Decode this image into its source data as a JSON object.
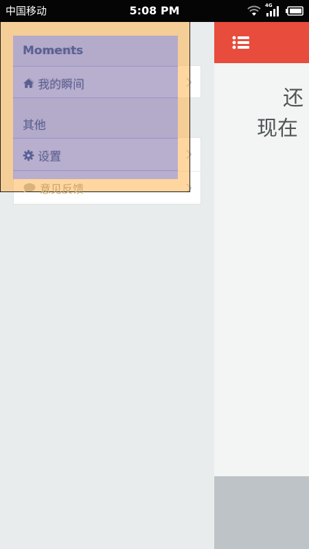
{
  "status_bar": {
    "carrier": "中国移动",
    "time": "5:08 PM",
    "network_type": "4G",
    "icons": [
      "wifi-icon",
      "signal-icon",
      "battery-icon"
    ]
  },
  "menu": {
    "sections": [
      {
        "title": "Moments",
        "items": [
          {
            "label": "我的瞬间",
            "icon": "home-icon"
          }
        ]
      },
      {
        "title": "其他",
        "items": [
          {
            "label": "设置",
            "icon": "gear-icon"
          },
          {
            "label": "意见反馈",
            "icon": "chat-bubble-icon"
          }
        ]
      }
    ]
  },
  "main": {
    "header_icon": "list-menu-icon",
    "text_line1": "还",
    "text_line2": "现在"
  },
  "colors": {
    "header_red": "#e74c3c",
    "overlay_orange": "#ffb450",
    "overlay_blue": "#8c96eb",
    "footer_gray": "#bdc3c6",
    "panel_bg": "#e9ecec"
  }
}
